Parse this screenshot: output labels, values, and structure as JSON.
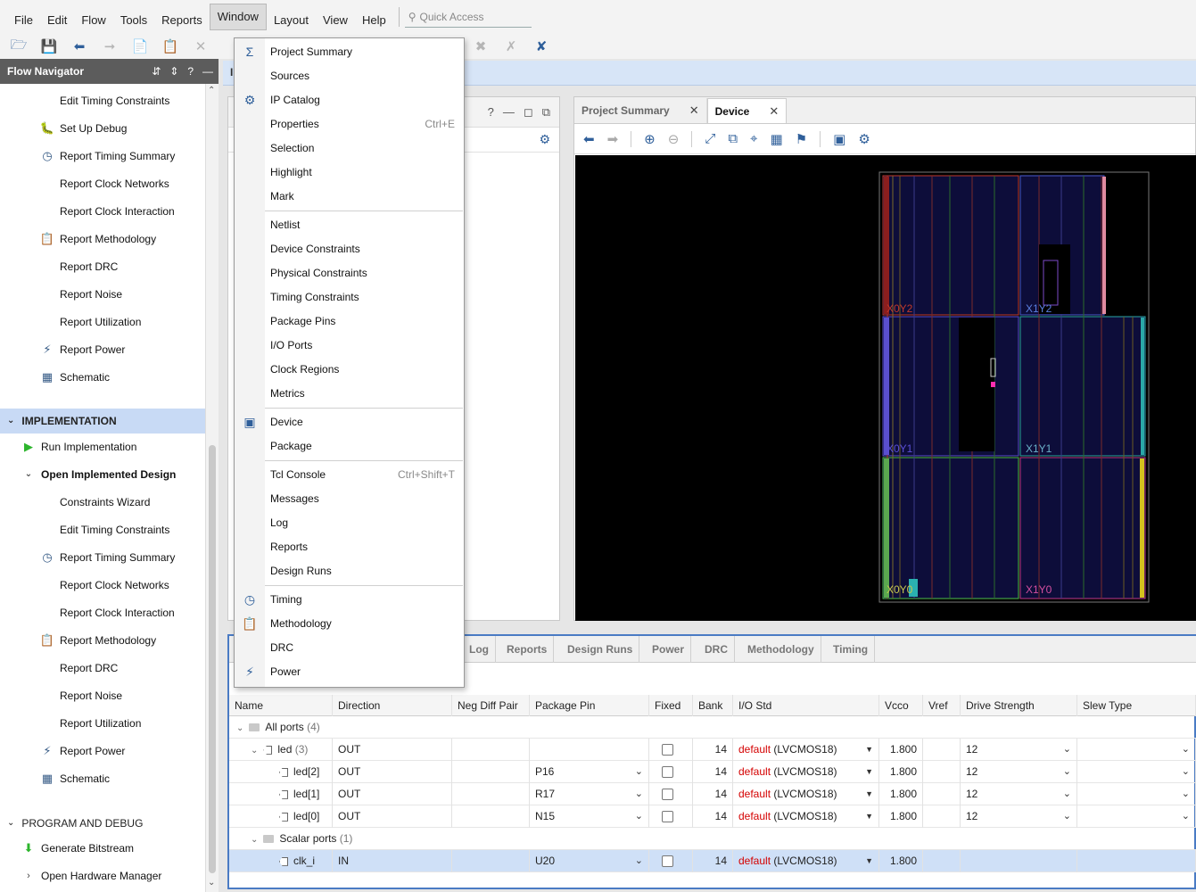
{
  "menubar": {
    "items": [
      "File",
      "Edit",
      "Flow",
      "Tools",
      "Reports",
      "Window",
      "Layout",
      "View",
      "Help"
    ],
    "active": "Window",
    "quick_access_placeholder": "Quick Access"
  },
  "flow_navigator": {
    "title": "Flow Navigator",
    "items_top": [
      {
        "label": "Edit Timing Constraints",
        "icon": ""
      },
      {
        "label": "Set Up Debug",
        "icon": "bug-icon"
      },
      {
        "label": "Report Timing Summary",
        "icon": "clock-icon"
      },
      {
        "label": "Report Clock Networks",
        "icon": ""
      },
      {
        "label": "Report Clock Interaction",
        "icon": ""
      },
      {
        "label": "Report Methodology",
        "icon": "clipboard-icon"
      },
      {
        "label": "Report DRC",
        "icon": ""
      },
      {
        "label": "Report Noise",
        "icon": ""
      },
      {
        "label": "Report Utilization",
        "icon": ""
      },
      {
        "label": "Report Power",
        "icon": "power-icon"
      },
      {
        "label": "Schematic",
        "icon": "schematic-icon"
      }
    ],
    "implementation": {
      "title": "IMPLEMENTATION",
      "run": "Run Implementation",
      "open": "Open Implemented Design",
      "items": [
        {
          "label": "Constraints Wizard",
          "icon": ""
        },
        {
          "label": "Edit Timing Constraints",
          "icon": ""
        },
        {
          "label": "Report Timing Summary",
          "icon": "clock-icon"
        },
        {
          "label": "Report Clock Networks",
          "icon": ""
        },
        {
          "label": "Report Clock Interaction",
          "icon": ""
        },
        {
          "label": "Report Methodology",
          "icon": "clipboard-icon"
        },
        {
          "label": "Report DRC",
          "icon": ""
        },
        {
          "label": "Report Noise",
          "icon": ""
        },
        {
          "label": "Report Utilization",
          "icon": ""
        },
        {
          "label": "Report Power",
          "icon": "power-icon"
        },
        {
          "label": "Schematic",
          "icon": "schematic-icon"
        }
      ]
    },
    "program": {
      "title": "PROGRAM AND DEBUG",
      "generate": "Generate Bitstream",
      "hardware": "Open Hardware Manager"
    }
  },
  "infobar_text": "I",
  "device_panel": {
    "tabs": [
      "Project Summary",
      "Device"
    ],
    "active_tab": "Device",
    "regions": [
      "X0Y2",
      "X1Y2",
      "X0Y1",
      "X1Y1",
      "X0Y0",
      "X1Y0"
    ]
  },
  "bottom_panel": {
    "tabs": [
      "Log",
      "Reports",
      "Design Runs",
      "Power",
      "DRC",
      "Methodology",
      "Timing"
    ],
    "columns": [
      "Name",
      "Direction",
      "Neg Diff Pair",
      "Package Pin",
      "Fixed",
      "Bank",
      "I/O Std",
      "Vcco",
      "Vref",
      "Drive Strength",
      "Slew Type"
    ],
    "all_ports": {
      "label": "All ports",
      "count": "(4)"
    },
    "led": {
      "label": "led",
      "count": "(3)",
      "direction": "OUT",
      "bank": "14",
      "iostd_default": "default",
      "iostd": "(LVCMOS18)",
      "vcco": "1.800",
      "drive": "12"
    },
    "rows": [
      {
        "name": "led[2]",
        "direction": "OUT",
        "pin": "P16",
        "bank": "14",
        "iostd_default": "default",
        "iostd": "(LVCMOS18)",
        "vcco": "1.800",
        "drive": "12"
      },
      {
        "name": "led[1]",
        "direction": "OUT",
        "pin": "R17",
        "bank": "14",
        "iostd_default": "default",
        "iostd": "(LVCMOS18)",
        "vcco": "1.800",
        "drive": "12"
      },
      {
        "name": "led[0]",
        "direction": "OUT",
        "pin": "N15",
        "bank": "14",
        "iostd_default": "default",
        "iostd": "(LVCMOS18)",
        "vcco": "1.800",
        "drive": "12"
      }
    ],
    "scalar_ports": {
      "label": "Scalar ports",
      "count": "(1)"
    },
    "clk": {
      "name": "clk_i",
      "direction": "IN",
      "pin": "U20",
      "bank": "14",
      "iostd_default": "default",
      "iostd": "(LVCMOS18)",
      "vcco": "1.800"
    }
  },
  "window_menu": {
    "groups": [
      [
        {
          "label": "Project Summary",
          "shortcut": "",
          "icon": "sigma-icon"
        },
        {
          "label": "Sources",
          "shortcut": "",
          "icon": ""
        },
        {
          "label": "IP Catalog",
          "shortcut": "",
          "icon": "ip-catalog-icon"
        },
        {
          "label": "Properties",
          "shortcut": "Ctrl+E",
          "icon": ""
        },
        {
          "label": "Selection",
          "shortcut": "",
          "icon": ""
        },
        {
          "label": "Highlight",
          "shortcut": "",
          "icon": ""
        },
        {
          "label": "Mark",
          "shortcut": "",
          "icon": ""
        }
      ],
      [
        {
          "label": "Netlist",
          "shortcut": "",
          "icon": ""
        },
        {
          "label": "Device Constraints",
          "shortcut": "",
          "icon": ""
        },
        {
          "label": "Physical Constraints",
          "shortcut": "",
          "icon": ""
        },
        {
          "label": "Timing Constraints",
          "shortcut": "",
          "icon": ""
        },
        {
          "label": "Package Pins",
          "shortcut": "",
          "icon": ""
        },
        {
          "label": "I/O Ports",
          "shortcut": "",
          "icon": ""
        },
        {
          "label": "Clock Regions",
          "shortcut": "",
          "icon": ""
        },
        {
          "label": "Metrics",
          "shortcut": "",
          "icon": ""
        }
      ],
      [
        {
          "label": "Device",
          "shortcut": "",
          "icon": "chip-icon"
        },
        {
          "label": "Package",
          "shortcut": "",
          "icon": ""
        }
      ],
      [
        {
          "label": "Tcl Console",
          "shortcut": "Ctrl+Shift+T",
          "icon": ""
        },
        {
          "label": "Messages",
          "shortcut": "",
          "icon": ""
        },
        {
          "label": "Log",
          "shortcut": "",
          "icon": ""
        },
        {
          "label": "Reports",
          "shortcut": "",
          "icon": ""
        },
        {
          "label": "Design Runs",
          "shortcut": "",
          "icon": ""
        }
      ],
      [
        {
          "label": "Timing",
          "shortcut": "",
          "icon": "clock-icon"
        },
        {
          "label": "Methodology",
          "shortcut": "",
          "icon": "clipboard-icon"
        },
        {
          "label": "DRC",
          "shortcut": "",
          "icon": ""
        },
        {
          "label": "Power",
          "shortcut": "",
          "icon": "power-icon"
        }
      ]
    ]
  }
}
